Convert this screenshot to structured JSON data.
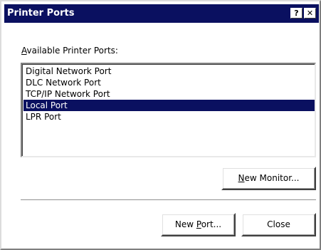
{
  "window": {
    "title": "Printer Ports",
    "help_glyph": "?",
    "close_glyph": "✕"
  },
  "ports_label": {
    "accel": "A",
    "rest": "vailable Printer Ports:"
  },
  "ports": [
    {
      "label": "Digital Network Port",
      "selected": false
    },
    {
      "label": "DLC Network Port",
      "selected": false
    },
    {
      "label": "TCP/IP Network Port",
      "selected": false
    },
    {
      "label": "Local Port",
      "selected": true
    },
    {
      "label": "LPR Port",
      "selected": false
    }
  ],
  "buttons": {
    "new_monitor": {
      "accel": "N",
      "rest": "ew Monitor..."
    },
    "new_port": {
      "pre": "New ",
      "accel": "P",
      "rest": "ort..."
    },
    "close": {
      "label": "Close"
    }
  },
  "colors": {
    "titlebar": "#0a1060",
    "selection": "#0a1060"
  }
}
